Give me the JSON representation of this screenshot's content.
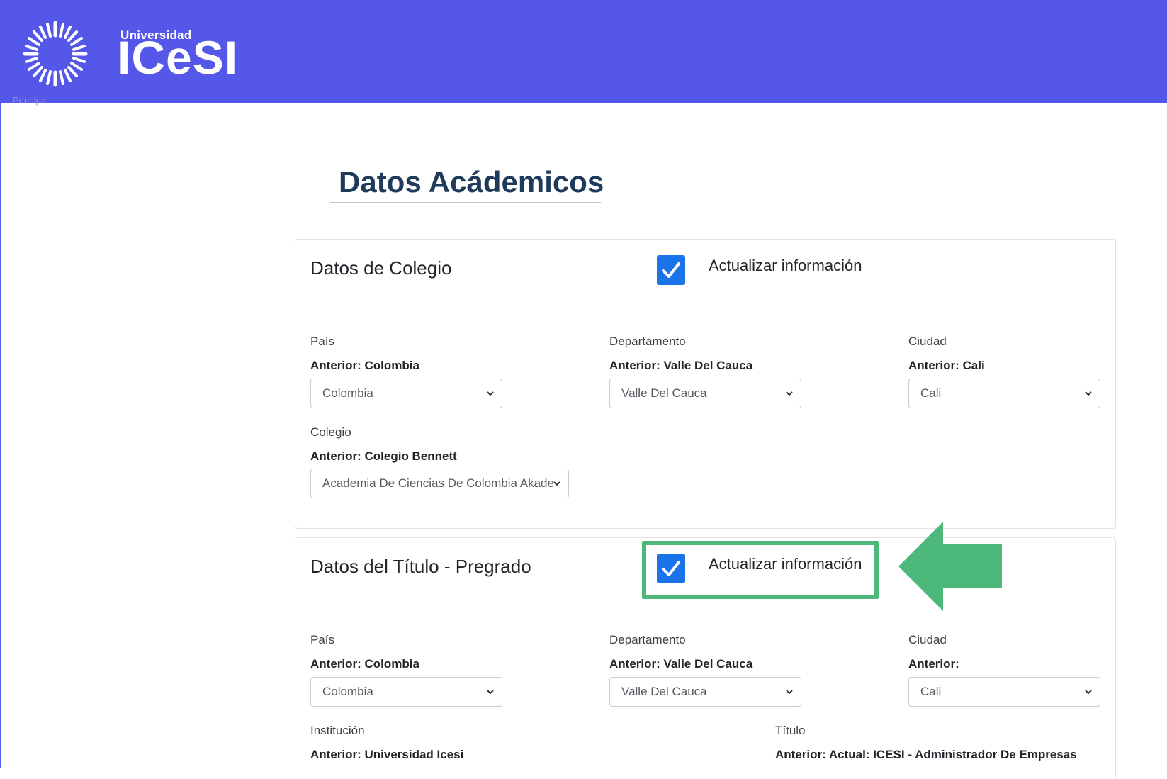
{
  "header": {
    "brand_small": "Universidad",
    "brand_big": "ICeSI",
    "accent_color": "#5457e8",
    "breadcrumb": "Principal"
  },
  "page": {
    "title": "Datos Acádemicos"
  },
  "colegio": {
    "title": "Datos de Colegio",
    "update_label": "Actualizar información",
    "update_checked": true,
    "fields": {
      "pais": {
        "label": "País",
        "previous": "Anterior: Colombia",
        "value": "Colombia"
      },
      "departamento": {
        "label": "Departamento",
        "previous": "Anterior: Valle Del Cauca",
        "value": "Valle Del Cauca"
      },
      "ciudad": {
        "label": "Ciudad",
        "previous": "Anterior: Cali",
        "value": "Cali"
      },
      "colegio": {
        "label": "Colegio",
        "previous": "Anterior: Colegio Bennett",
        "value": "Academia De Ciencias De Colombia Akade"
      }
    }
  },
  "titulo": {
    "title": "Datos del Título - Pregrado",
    "update_label": "Actualizar información",
    "update_checked": true,
    "highlight_color": "#4cb87a",
    "fields": {
      "pais": {
        "label": "País",
        "previous": "Anterior: Colombia",
        "value": "Colombia"
      },
      "departamento": {
        "label": "Departamento",
        "previous": "Anterior: Valle Del Cauca",
        "value": "Valle Del Cauca"
      },
      "ciudad": {
        "label": "Ciudad",
        "previous": "Anterior:",
        "value": "Cali"
      },
      "institucion": {
        "label": "Institución",
        "previous": "Anterior: Universidad Icesi"
      },
      "titulo": {
        "label": "Título",
        "previous": "Anterior: Actual: ICESI - Administrador De Empresas"
      }
    }
  },
  "icons": {
    "checkbox": "check-icon",
    "select": "chevron-down-icon",
    "callout": "arrow-left-icon"
  }
}
